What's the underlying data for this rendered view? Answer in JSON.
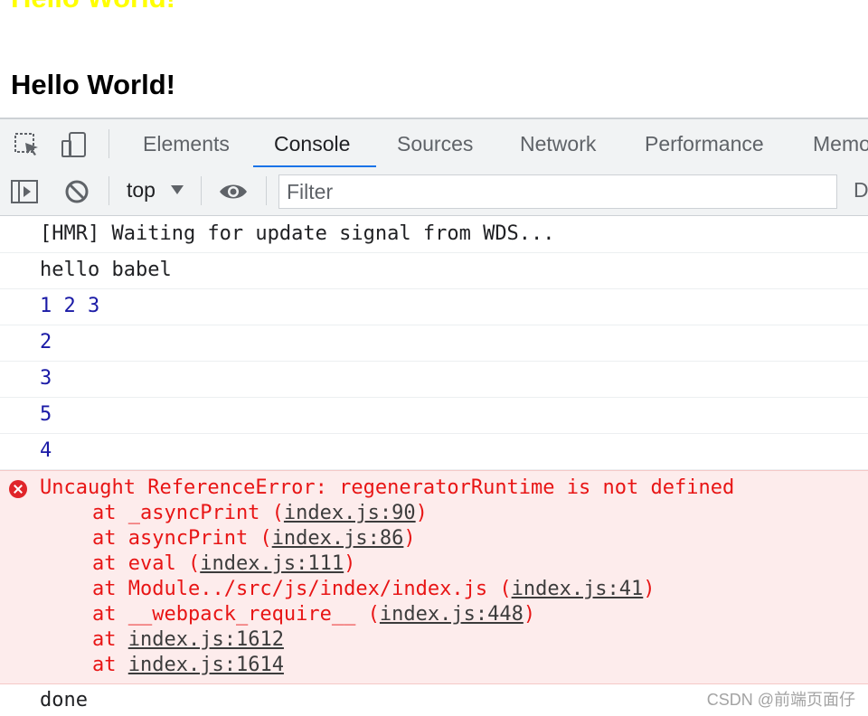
{
  "page": {
    "heading_yellow": "Hello World!",
    "heading_black": "Hello World!"
  },
  "devtools": {
    "tabs": [
      "Elements",
      "Console",
      "Sources",
      "Network",
      "Performance",
      "Memo"
    ],
    "active_tab": "Console",
    "accent_color": "#1a73e8"
  },
  "toolbar": {
    "context": "top",
    "filter_placeholder": "Filter",
    "cut_text": "D",
    "icons": [
      "sidebar-toggle-icon",
      "clear-console-icon",
      "eye-icon"
    ]
  },
  "console": {
    "logs": [
      {
        "text": "[HMR] Waiting for update signal from WDS...",
        "type": "log"
      },
      {
        "text": "hello babel",
        "type": "log"
      },
      {
        "text": "1 2 3",
        "type": "number"
      },
      {
        "text": "2",
        "type": "number"
      },
      {
        "text": "3",
        "type": "number"
      },
      {
        "text": "5",
        "type": "number"
      },
      {
        "text": "4",
        "type": "number"
      }
    ],
    "error": {
      "message": "Uncaught ReferenceError: regeneratorRuntime is not defined",
      "color": "#e81515",
      "trace": [
        {
          "pre": "at _asyncPrint (",
          "link": "index.js:90",
          "post": ")"
        },
        {
          "pre": "at asyncPrint (",
          "link": "index.js:86",
          "post": ")"
        },
        {
          "pre": "at eval (",
          "link": "index.js:111",
          "post": ")"
        },
        {
          "pre": "at Module../src/js/index/index.js (",
          "link": "index.js:41",
          "post": ")"
        },
        {
          "pre": "at __webpack_require__ (",
          "link": "index.js:448",
          "post": ")"
        },
        {
          "pre": "at ",
          "link": "index.js:1612",
          "post": ""
        },
        {
          "pre": "at ",
          "link": "index.js:1614",
          "post": ""
        }
      ]
    },
    "last_log": "done"
  },
  "watermark": "CSDN @前端页面仔"
}
